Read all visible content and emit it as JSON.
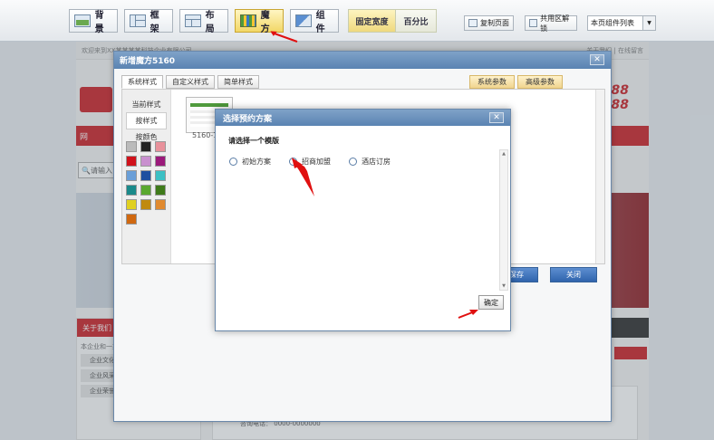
{
  "toolbar": {
    "background": "背景",
    "frame": "框架",
    "layout": "布局",
    "magic": "魔方",
    "widget": "组件",
    "fixed_width": "固定宽度",
    "percent": "百分比",
    "copy_page": "复制页面",
    "share_lock": "共用区解锁",
    "widget_list": "本页组件列表"
  },
  "site": {
    "welcome": "欢迎来到XX某某某某科技企业有限公司",
    "top_right": "关于我们 | 在线留言",
    "phone_line1": "688",
    "phone_line2": "888",
    "nav_text": "网",
    "search_placeholder": "请输入",
    "left_heading": "关于我们",
    "left_text": "本企业和一某某某某...",
    "left_items": [
      "企业文化",
      "企业风采",
      "企业荣誉"
    ],
    "contact_label": "咨询电话：",
    "contact_number": "0000-0000000"
  },
  "dialog": {
    "title": "新增魔方5160",
    "close": "✕",
    "tabs": [
      "系统样式",
      "自定义样式",
      "简单样式"
    ],
    "right_tabs": [
      "系统参数",
      "高级参数"
    ],
    "left_items": [
      "当前样式",
      "按样式",
      "按颜色"
    ],
    "thumb_label": "5160-1",
    "save": "保存",
    "close_btn": "关闭",
    "swatches": [
      "#bbbbbb",
      "#222222",
      "#e8919b",
      "#d0121b",
      "#c990cf",
      "#9b1a7a",
      "#6a9fd8",
      "#1d4fa0",
      "#3cc0c4",
      "#1a8a8a",
      "#5aa82f",
      "#3f7a1a",
      "#e0d020",
      "#c08a10",
      "#e08a30",
      "#d06810"
    ]
  },
  "sub_dialog": {
    "title": "选择预约方案",
    "close": "✕",
    "prompt": "请选择一个模版",
    "options": [
      "初始方案",
      "招商加盟",
      "酒店订房"
    ],
    "ok": "确定"
  },
  "colors": {
    "accent_red": "#c8141b",
    "title_blue": "#5a83b2",
    "arrow_red": "#e01010"
  }
}
